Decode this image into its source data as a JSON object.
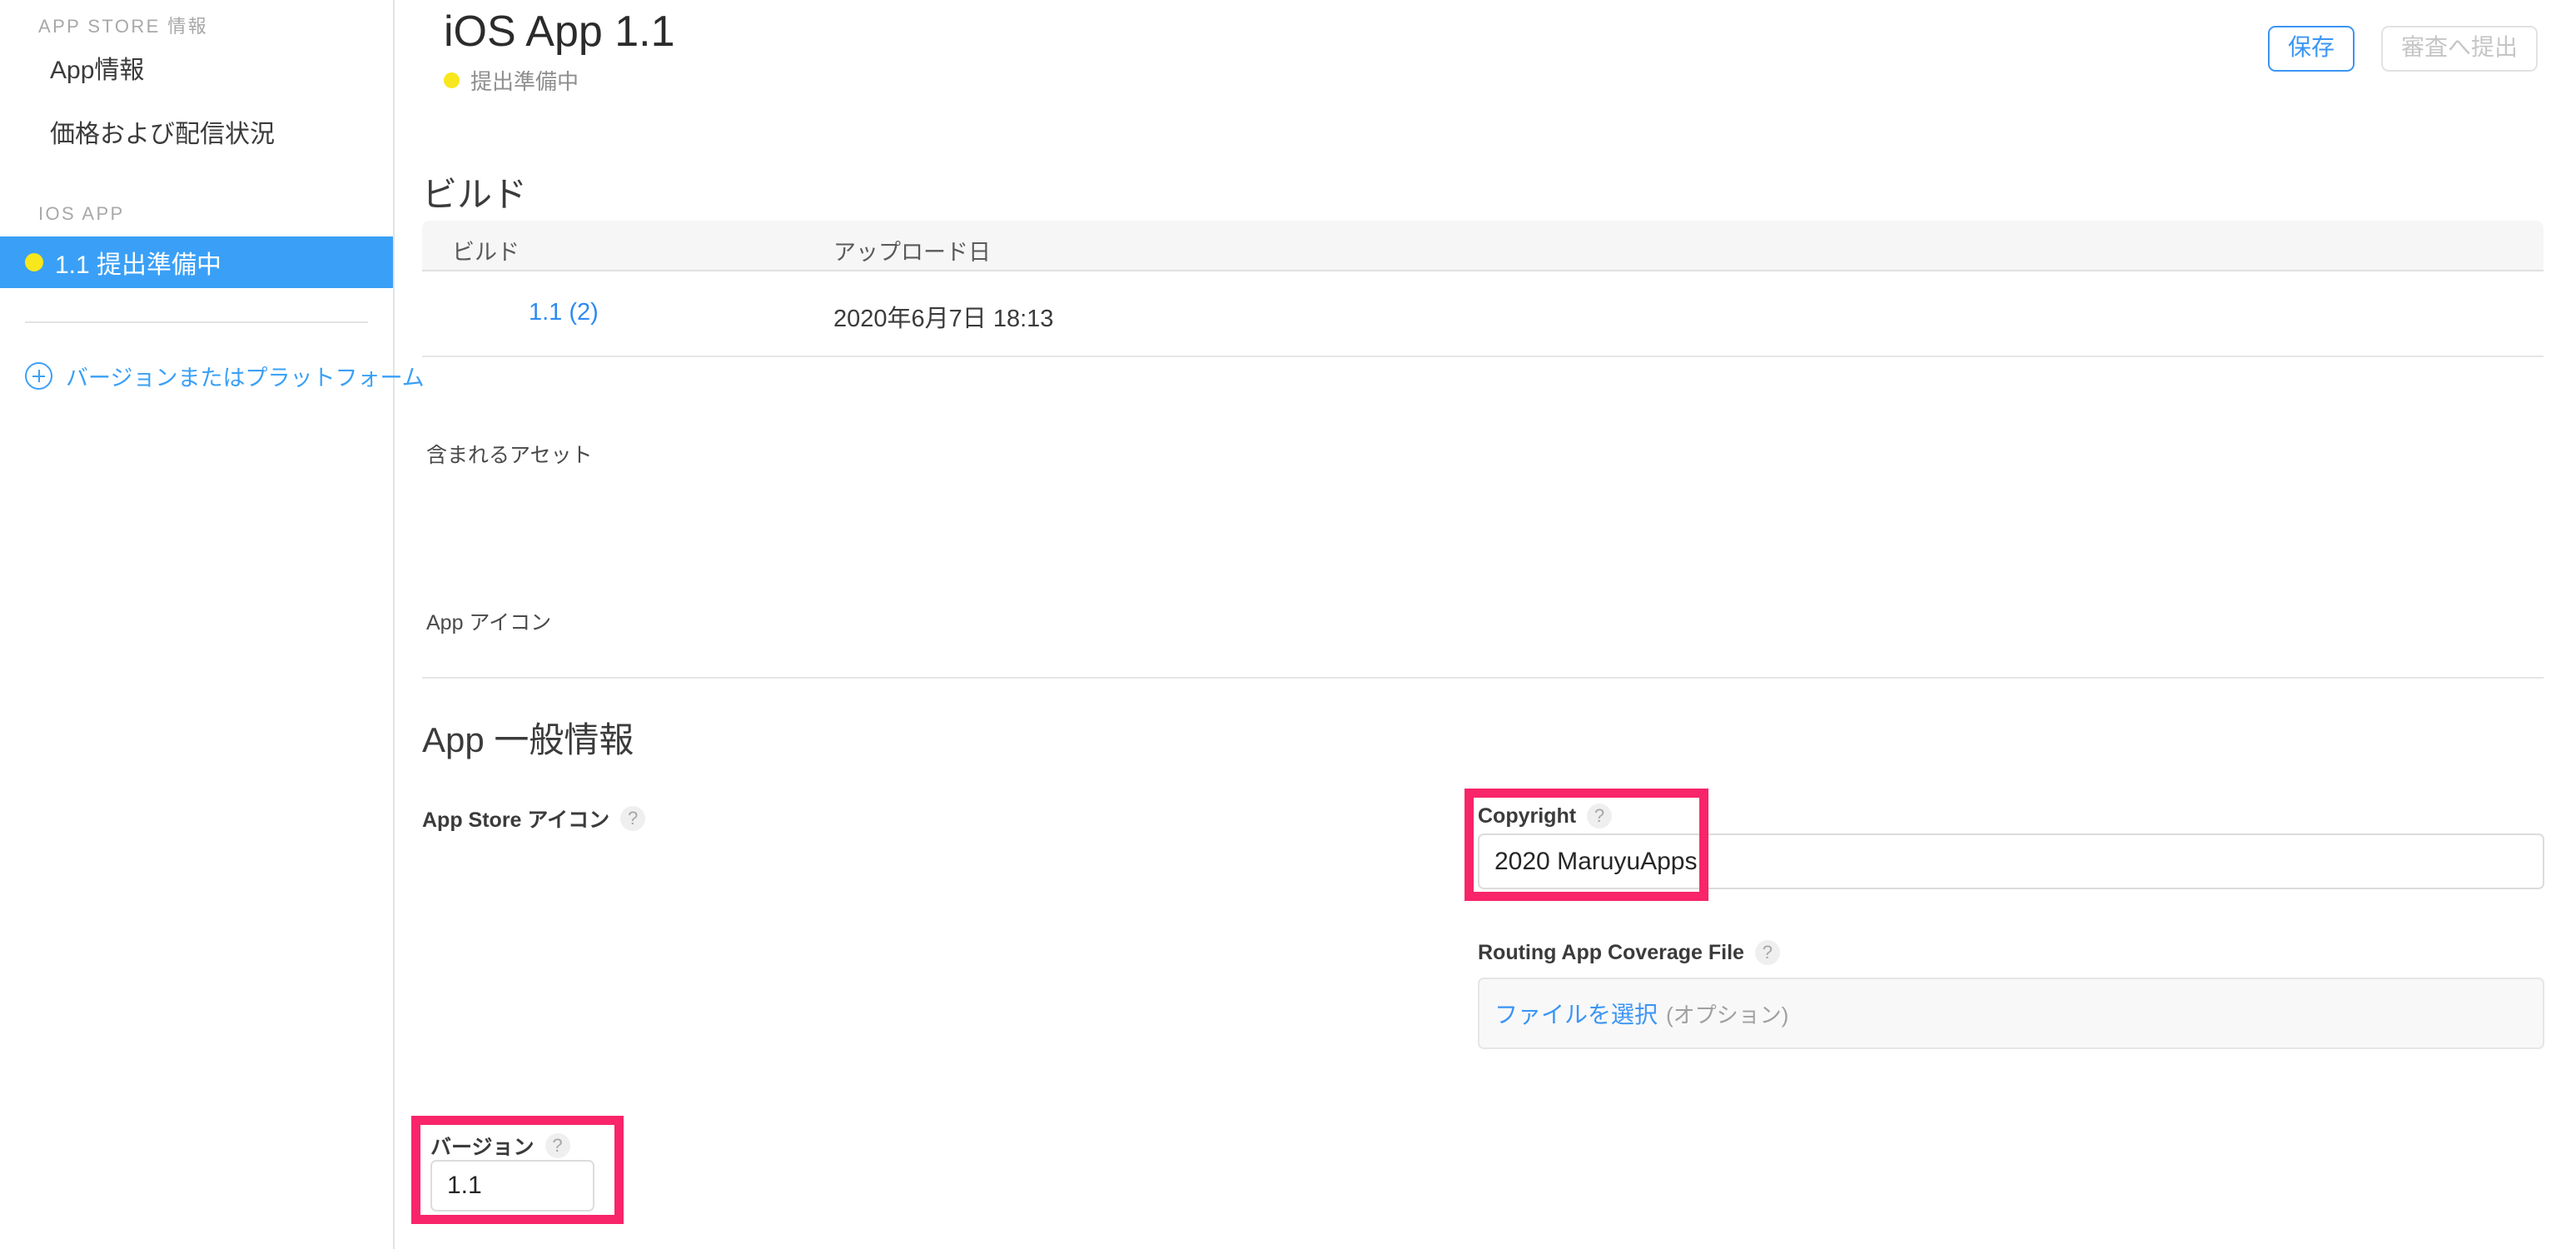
{
  "sidebar": {
    "group1_heading": "APP STORE 情報",
    "links": [
      {
        "label": "App情報"
      },
      {
        "label": "価格および配信状況"
      }
    ],
    "group2_heading": "IOS APP",
    "version_item": {
      "label": "1.1 提出準備中",
      "status_color": "#f8e71c",
      "active_color": "#3aa0f7"
    },
    "add_label": "バージョンまたはプラットフォーム",
    "add_icon": "plus-circle-icon",
    "link_color": "#3aa0f7"
  },
  "header": {
    "title": "iOS App 1.1",
    "status": "提出準備中",
    "status_color": "#f8e71c",
    "save_label": "保存",
    "submit_label": "審査へ提出",
    "save_color": "#3b95f5",
    "submit_color": "#c6c6c6"
  },
  "build_section": {
    "title": "ビルド",
    "columns": [
      "ビルド",
      "アップロード日"
    ],
    "rows": [
      {
        "icon": "app-icon-thumb",
        "build": "1.1 (2)",
        "uploaded": "2020年6月7日 18:13"
      }
    ],
    "assets_label": "含まれるアセット",
    "asset_caption": "App アイコン",
    "link_color": "#2e8bf0"
  },
  "general_section": {
    "title": "App 一般情報",
    "app_store_icon": {
      "label": "App Store アイコン",
      "help": "?"
    },
    "version": {
      "label": "バージョン",
      "help": "?",
      "value": "1.1",
      "highlight_color": "#f8256a"
    },
    "copyright": {
      "label": "Copyright",
      "help": "?",
      "value": "2020 MaruyuApps",
      "highlight_color": "#f8256a"
    },
    "routing_file": {
      "label": "Routing App Coverage File",
      "help": "?",
      "choose_label": "ファイルを選択",
      "optional_label": "(オプション)",
      "link_color": "#3b95f5"
    }
  }
}
